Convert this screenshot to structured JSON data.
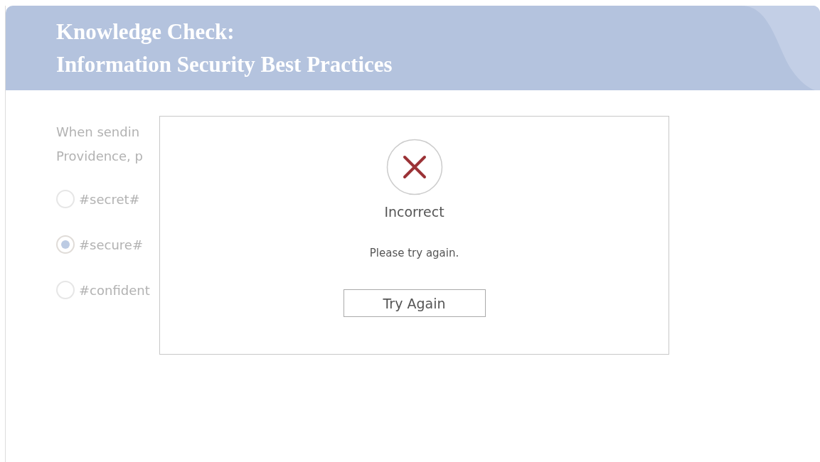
{
  "header": {
    "title_lines": [
      "Knowledge Check:",
      "Information Security Best Practices"
    ]
  },
  "question": {
    "lines": [
      "When sendin",
      "Providence, p"
    ]
  },
  "options": [
    {
      "label": "#secret#",
      "selected": false
    },
    {
      "label": "#secure#",
      "selected": true
    },
    {
      "label": "#confident",
      "selected": false
    }
  ],
  "feedback": {
    "correct": false,
    "heading": "Incorrect",
    "message": "Please try again.",
    "button": "Try Again"
  }
}
